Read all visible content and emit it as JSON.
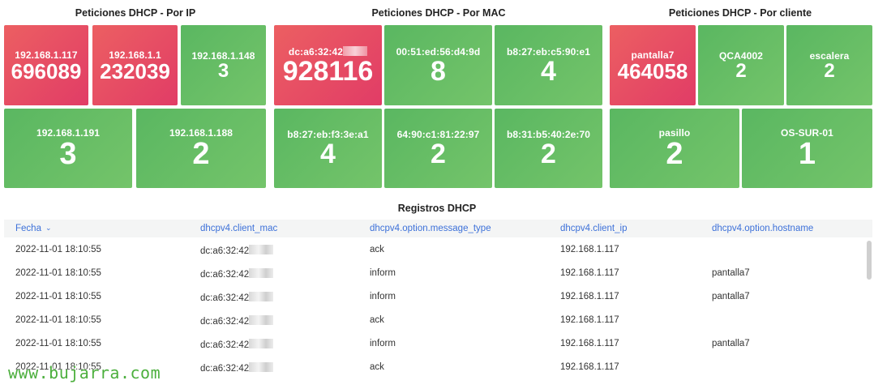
{
  "panels": {
    "ip": {
      "title": "Peticiones DHCP - Por IP",
      "tiles": [
        {
          "label": "192.168.1.117",
          "value": "696089",
          "status": "red"
        },
        {
          "label": "192.168.1.1",
          "value": "232039",
          "status": "red"
        },
        {
          "label": "192.168.1.148",
          "value": "3",
          "status": "green"
        },
        {
          "label": "192.168.1.191",
          "value": "3",
          "status": "green"
        },
        {
          "label": "192.168.1.188",
          "value": "2",
          "status": "green"
        }
      ]
    },
    "mac": {
      "title": "Peticiones DHCP - Por MAC",
      "tiles": [
        {
          "label": "dc:a6:32:42",
          "value": "928116",
          "status": "red"
        },
        {
          "label": "00:51:ed:56:d4:9d",
          "value": "8",
          "status": "green"
        },
        {
          "label": "b8:27:eb:c5:90:e1",
          "value": "4",
          "status": "green"
        },
        {
          "label": "b8:27:eb:f3:3e:a1",
          "value": "4",
          "status": "green"
        },
        {
          "label": "64:90:c1:81:22:97",
          "value": "2",
          "status": "green"
        },
        {
          "label": "b8:31:b5:40:2e:70",
          "value": "2",
          "status": "green"
        }
      ]
    },
    "client": {
      "title": "Peticiones DHCP - Por cliente",
      "tiles": [
        {
          "label": "pantalla7",
          "value": "464058",
          "status": "red"
        },
        {
          "label": "QCA4002",
          "value": "2",
          "status": "green"
        },
        {
          "label": "escalera",
          "value": "2",
          "status": "green"
        },
        {
          "label": "pasillo",
          "value": "2",
          "status": "green"
        },
        {
          "label": "OS-SUR-01",
          "value": "1",
          "status": "green"
        }
      ]
    }
  },
  "logs": {
    "title": "Registros DHCP",
    "columns": [
      "Fecha",
      "dhcpv4.client_mac",
      "dhcpv4.option.message_type",
      "dhcpv4.client_ip",
      "dhcpv4.option.hostname"
    ],
    "sort_icon": "chevron-down-icon",
    "rows": [
      [
        "2022-11-01 18:10:55",
        "dc:a6:32:42",
        "ack",
        "192.168.1.117",
        ""
      ],
      [
        "2022-11-01 18:10:55",
        "dc:a6:32:42",
        "inform",
        "192.168.1.117",
        "pantalla7"
      ],
      [
        "2022-11-01 18:10:55",
        "dc:a6:32:42",
        "inform",
        "192.168.1.117",
        "pantalla7"
      ],
      [
        "2022-11-01 18:10:55",
        "dc:a6:32:42",
        "ack",
        "192.168.1.117",
        ""
      ],
      [
        "2022-11-01 18:10:55",
        "dc:a6:32:42",
        "inform",
        "192.168.1.117",
        "pantalla7"
      ],
      [
        "2022-11-01 18:10:55",
        "dc:a6:32:42",
        "ack",
        "192.168.1.117",
        ""
      ]
    ]
  },
  "watermark": "www.bujarra.com",
  "colors": {
    "red": "#e5496a",
    "green": "#66bd63",
    "header_link": "#3d71d9"
  }
}
